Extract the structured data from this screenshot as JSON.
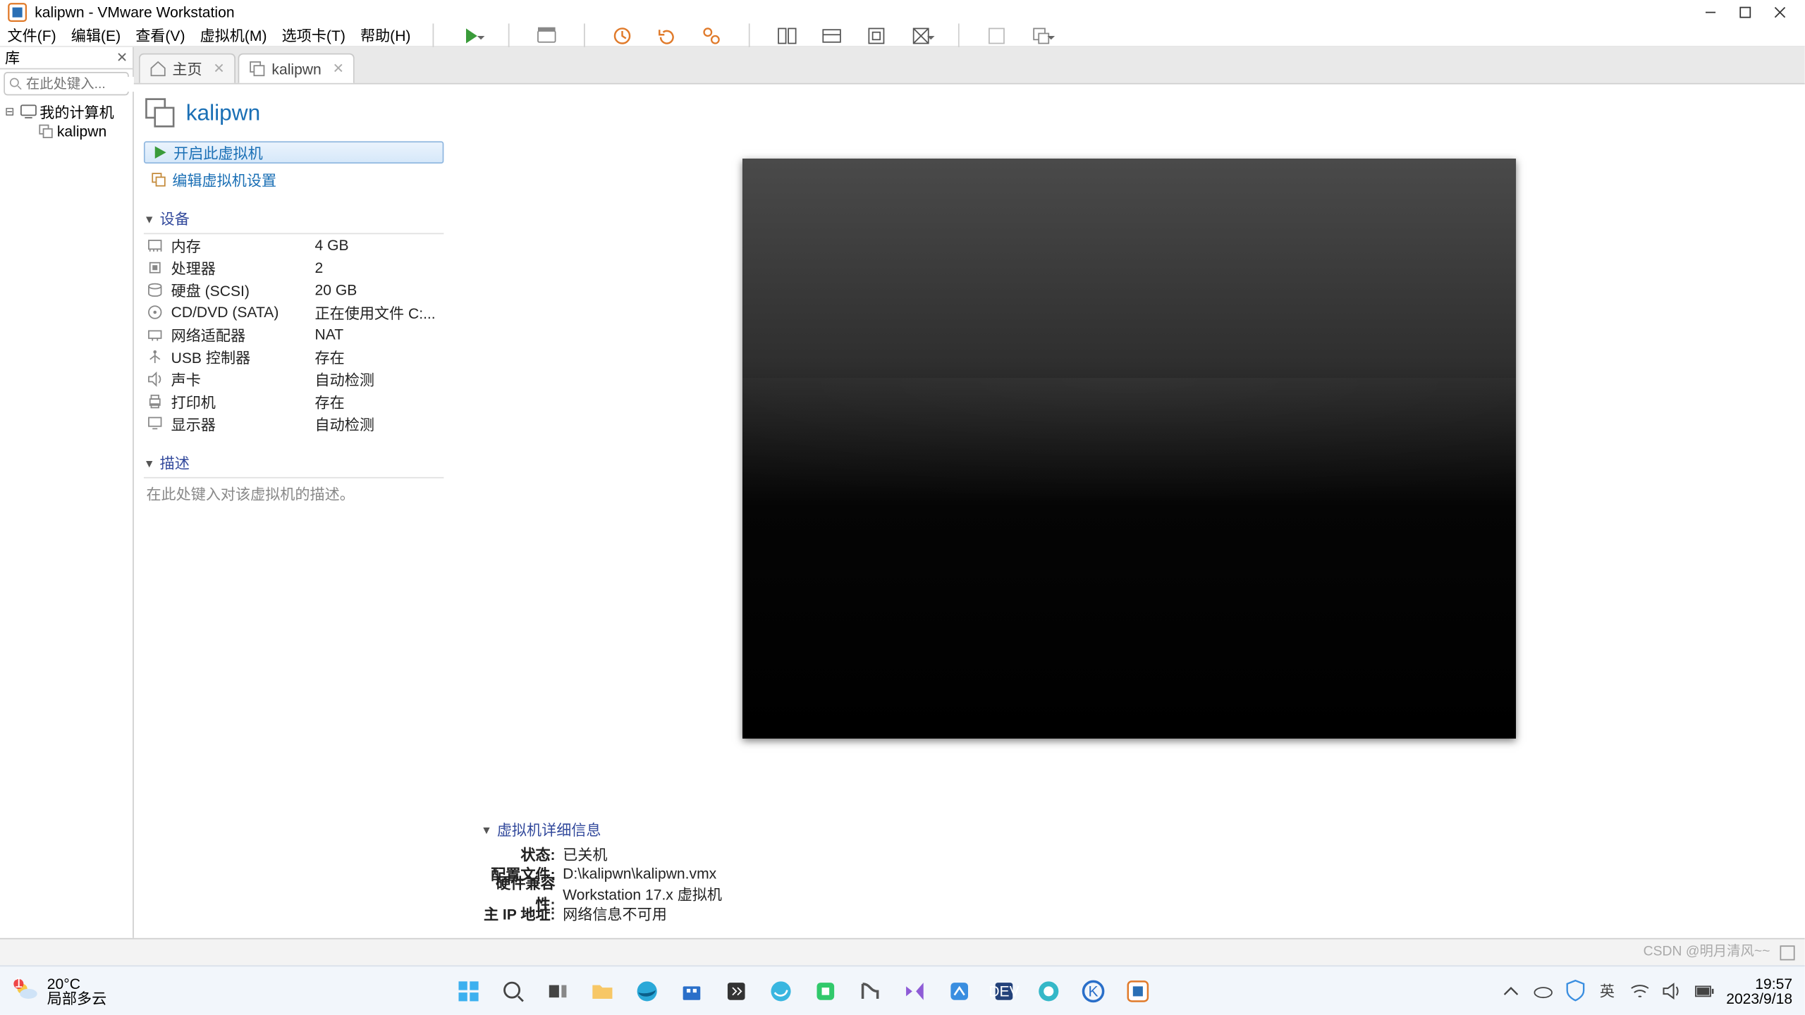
{
  "titlebar": {
    "title": "kalipwn - VMware Workstation"
  },
  "menubar": {
    "items": [
      "文件(F)",
      "编辑(E)",
      "查看(V)",
      "虚拟机(M)",
      "选项卡(T)",
      "帮助(H)"
    ]
  },
  "library": {
    "header": "库",
    "search_placeholder": "在此处键入...",
    "root": "我的计算机",
    "vm": "kalipwn"
  },
  "tabs": {
    "home": "主页",
    "vm": "kalipwn"
  },
  "vm": {
    "name": "kalipwn",
    "actions": {
      "power_on": "开启此虚拟机",
      "edit_settings": "编辑虚拟机设置"
    },
    "sections": {
      "devices": "设备",
      "description": "描述",
      "details": "虚拟机详细信息"
    },
    "devices": [
      {
        "icon": "memory",
        "label": "内存",
        "value": "4 GB"
      },
      {
        "icon": "cpu",
        "label": "处理器",
        "value": "2"
      },
      {
        "icon": "disk",
        "label": "硬盘 (SCSI)",
        "value": "20 GB"
      },
      {
        "icon": "cd",
        "label": "CD/DVD (SATA)",
        "value": "正在使用文件 C:..."
      },
      {
        "icon": "net",
        "label": "网络适配器",
        "value": "NAT"
      },
      {
        "icon": "usb",
        "label": "USB 控制器",
        "value": "存在"
      },
      {
        "icon": "sound",
        "label": "声卡",
        "value": "自动检测"
      },
      {
        "icon": "printer",
        "label": "打印机",
        "value": "存在"
      },
      {
        "icon": "display",
        "label": "显示器",
        "value": "自动检测"
      }
    ],
    "description_placeholder": "在此处键入对该虚拟机的描述。",
    "details": {
      "state_k": "状态:",
      "state_v": "已关机",
      "config_k": "配置文件:",
      "config_v": "D:\\kalipwn\\kalipwn.vmx",
      "compat_k": "硬件兼容性:",
      "compat_v": "Workstation 17.x 虚拟机",
      "ip_k": "主 IP 地址:",
      "ip_v": "网络信息不可用"
    }
  },
  "taskbar": {
    "weather_temp": "20°C",
    "weather_desc": "局部多云",
    "ime": "英",
    "time": "19:57",
    "date": "2023/9/18"
  },
  "watermark": "CSDN @明月清风~~"
}
